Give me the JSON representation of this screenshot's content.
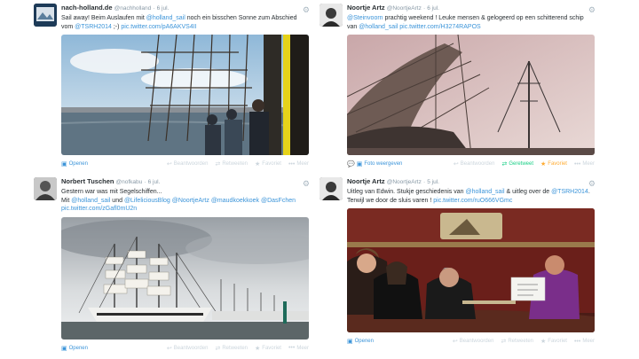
{
  "tweets": [
    {
      "fullname": "nach-holland.de",
      "handle": "@nachholland",
      "time": "6 jul.",
      "text_parts": [
        "Sail away! Beim Auslaufen mit ",
        "@holland_sail",
        " noch ein bisschen Sonne zum Abschied vom ",
        "@TSRH2014",
        " ;-) ",
        "pic.twitter.com/pA6AKVS4II"
      ],
      "action_primary": "Openen",
      "actions": [
        "Beantwoorden",
        "Retweeten",
        "Favoriet",
        "Meer"
      ]
    },
    {
      "fullname": "Noortje Artz",
      "handle": "@NoortjeArtz",
      "time": "6 jul.",
      "text_parts": [
        "@Steinvoorn",
        " prachtig weekend ! Leuke mensen & gelogeerd op een schitterend schip van ",
        "@holland_sail",
        " ",
        "pic.twitter.com/H3274RAPOS"
      ],
      "action_primary": "Foto weergeven",
      "actions": [
        "Beantwoorden",
        "Geretweet",
        "Favoriet",
        "Meer"
      ]
    },
    {
      "fullname": "Norbert Tuschen",
      "handle": "@nofkabu",
      "time": "6 jul.",
      "text_line1": "Gestern war was mit Segelschiffen...",
      "text_parts": [
        "Mit ",
        "@holland_sail",
        " und ",
        "@LifeliciousBlog",
        " ",
        "@NoortjeArtz",
        " ",
        "@maudkoekkoek",
        " ",
        "@DasFchen",
        " ",
        "pic.twitter.com/zGafl0mU2n"
      ],
      "action_primary": "Openen",
      "actions": [
        "Beantwoorden",
        "Retweeten",
        "Favoriet",
        "Meer"
      ]
    },
    {
      "fullname": "Noortje Artz",
      "handle": "@NoortjeArtz",
      "time": "5 jul.",
      "text_parts": [
        "Uitleg van Edwin. Stukje geschiedenis van ",
        "@holland_sail",
        " & uitleg over de ",
        "@TSRH2014",
        ". Terwijl we door de sluis varen ! ",
        "pic.twitter.com/ruO666VGmc"
      ],
      "action_primary": "Openen",
      "actions": [
        "Beantwoorden",
        "Retweeten",
        "Favoriet",
        "Meer"
      ]
    }
  ],
  "colors": {
    "link": "#3b94d9",
    "retweeted": "#19cf86",
    "favorited": "#ffac33",
    "muted": "#ccd6dd"
  },
  "icons": {
    "open": "photo-icon",
    "reply": "reply-icon",
    "retweet": "retweet-icon",
    "favorite": "star-icon",
    "more": "more-icon",
    "settings": "gear-icon"
  }
}
